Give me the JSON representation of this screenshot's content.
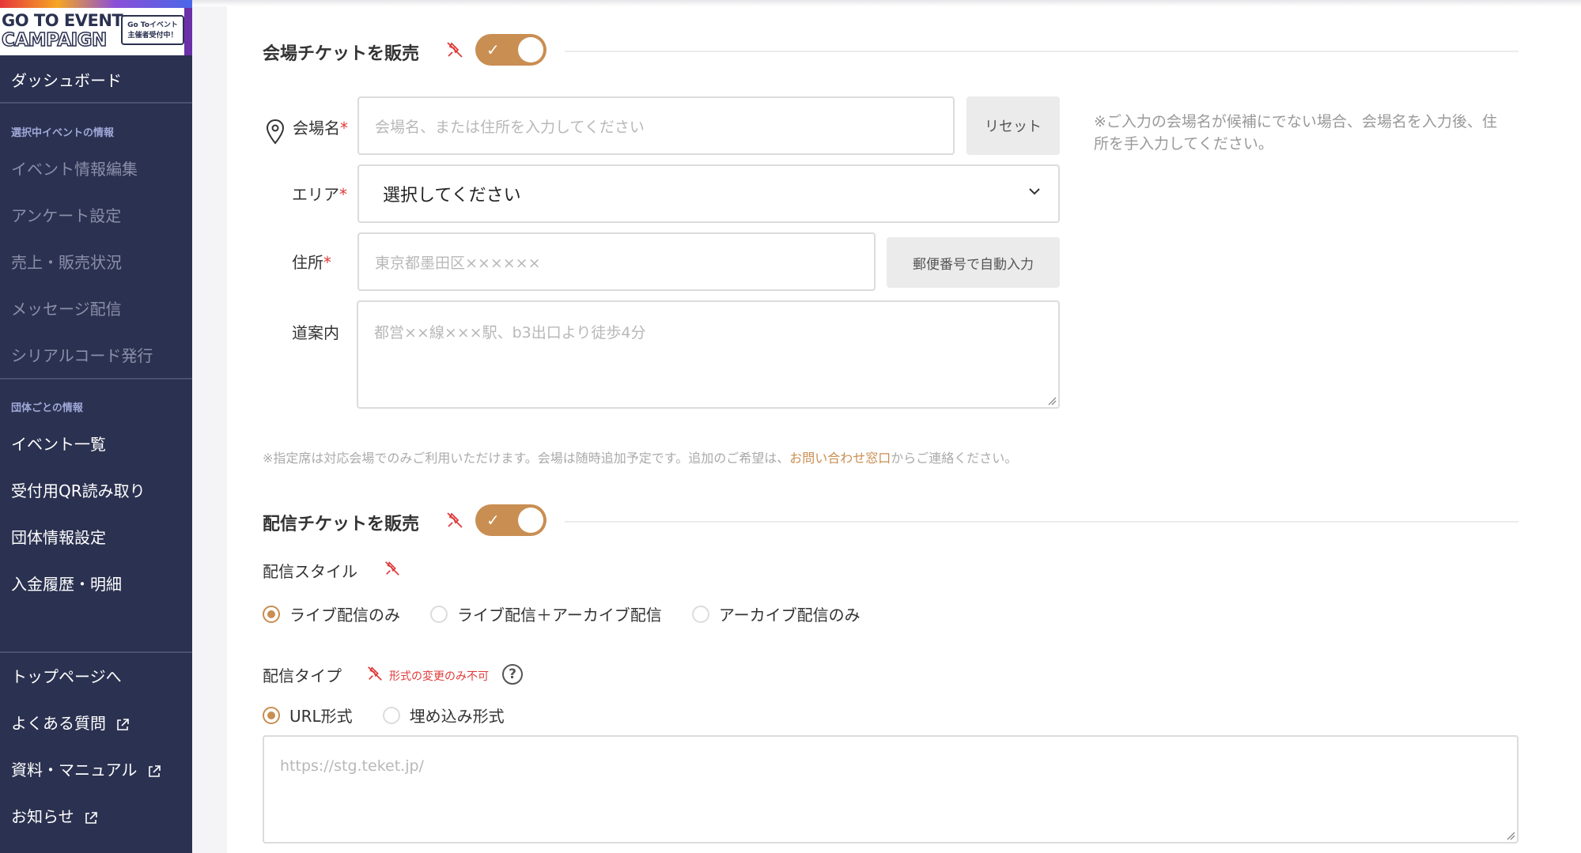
{
  "sidebar": {
    "logo": {
      "line1": "GO TO EVENT",
      "line2": "CAMPAIGN",
      "badge_line1": "Go Toイベント",
      "badge_line2": "主催者受付中！"
    },
    "dashboard": "ダッシュボード",
    "section_event": "選択中イベントの情報",
    "event_items": [
      "イベント情報編集",
      "アンケート設定",
      "売上・販売状況",
      "メッセージ配信",
      "シリアルコード発行"
    ],
    "section_group": "団体ごとの情報",
    "group_items": [
      "イベント一覧",
      "受付用QR読み取り",
      "団体情報設定",
      "入金履歴・明細"
    ],
    "bottom_items": [
      "トップページへ",
      "よくある質問",
      "資料・マニュアル",
      "お知らせ"
    ]
  },
  "venue": {
    "title": "会場チケットを販売",
    "toggle_on": true,
    "name_label": "会場名",
    "name_placeholder": "会場名、または住所を入力してください",
    "reset_label": "リセット",
    "note": "※ご入力の会場名が候補にでない場合、会場名を入力後、住所を手入力してください。",
    "area_label": "エリア",
    "area_value": "選択してください",
    "address_label": "住所",
    "address_placeholder": "東京都墨田区××××××",
    "zip_button": "郵便番号で自動入力",
    "guide_label": "道案内",
    "guide_placeholder": "都営××線×××駅、b3出口より徒歩4分",
    "required_mark": "*",
    "fine_print_before": "※指定席は対応会場でのみご利用いただけます。会場は随時追加予定です。追加のご希望は、",
    "fine_print_link": "お問い合わせ窓口",
    "fine_print_after": "からご連絡ください。"
  },
  "stream": {
    "title": "配信チケットを販売",
    "toggle_on": true,
    "style_label": "配信スタイル",
    "style_options": [
      "ライブ配信のみ",
      "ライブ配信＋アーカイブ配信",
      "アーカイブ配信のみ"
    ],
    "style_selected": 0,
    "type_label": "配信タイプ",
    "type_note": "形式の変更のみ不可",
    "help_symbol": "?",
    "type_options": [
      "URL形式",
      "埋め込み形式"
    ],
    "type_selected": 0,
    "url_placeholder": "https://stg.teket.jp/"
  },
  "colors": {
    "accent": "#c98e52",
    "sidebar_bg": "#2b3150",
    "required": "#e03a3a"
  }
}
